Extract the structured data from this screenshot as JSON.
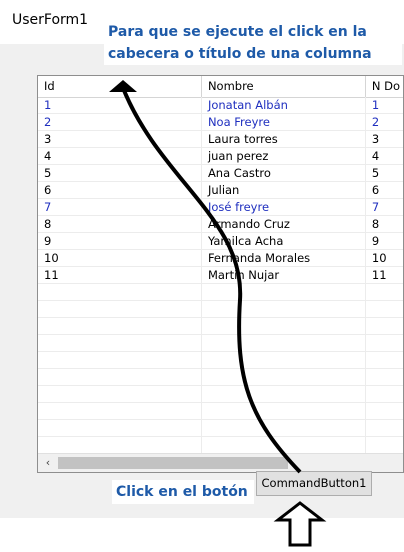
{
  "window": {
    "title": "UserForm1"
  },
  "annotations": {
    "top": "Para que se ejecute el click en la cabecera o título de una columna",
    "bottom": "Click en el botón"
  },
  "listbox": {
    "headers": [
      "Id",
      "Nombre",
      "N Do"
    ],
    "rows": [
      {
        "id": "1",
        "nombre": "Jonatan Albán",
        "n": "1",
        "color": "blue"
      },
      {
        "id": "2",
        "nombre": "Noa Freyre",
        "n": "2",
        "color": "blue"
      },
      {
        "id": "3",
        "nombre": "Laura torres",
        "n": "3",
        "color": "black"
      },
      {
        "id": "4",
        "nombre": "juan perez",
        "n": "4",
        "color": "black"
      },
      {
        "id": "5",
        "nombre": "Ana Castro",
        "n": "5",
        "color": "black"
      },
      {
        "id": "6",
        "nombre": "Julian",
        "n": "6",
        "color": "black"
      },
      {
        "id": "7",
        "nombre": "José freyre",
        "n": "7",
        "color": "blue"
      },
      {
        "id": "8",
        "nombre": "Armando Cruz",
        "n": "8",
        "color": "black"
      },
      {
        "id": "9",
        "nombre": "Yamilca Acha",
        "n": "9",
        "color": "black"
      },
      {
        "id": "10",
        "nombre": "Fernanda Morales",
        "n": "10",
        "color": "black"
      },
      {
        "id": "11",
        "nombre": "Martin Nujar",
        "n": "11",
        "color": "black"
      }
    ],
    "scroll_left_icon": "arrow-left-icon"
  },
  "command_button": {
    "label": "CommandButton1"
  },
  "colors": {
    "annotation_text": "#1e5aa8",
    "blue_row": "#1f2fbf"
  }
}
